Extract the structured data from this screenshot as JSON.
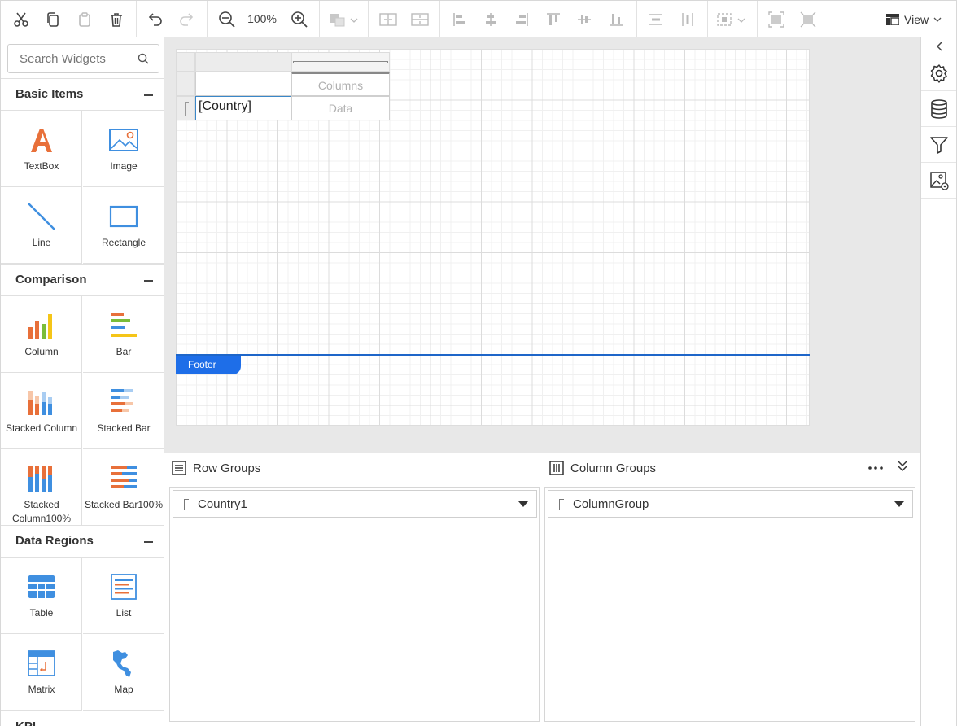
{
  "toolbar": {
    "zoom": "100%",
    "view_label": "View"
  },
  "search": {
    "placeholder": "Search Widgets"
  },
  "categories": {
    "basic": "Basic Items",
    "comparison": "Comparison",
    "data_regions": "Data Regions",
    "kpi": "KPI"
  },
  "widgets": {
    "textbox": "TextBox",
    "image": "Image",
    "line": "Line",
    "rectangle": "Rectangle",
    "column": "Column",
    "bar": "Bar",
    "stacked_column": "Stacked Column",
    "stacked_bar": "Stacked Bar",
    "stacked_column100": "Stacked Column100%",
    "stacked_bar100": "Stacked Bar100%",
    "table": "Table",
    "list": "List",
    "matrix": "Matrix",
    "map": "Map"
  },
  "design": {
    "row_cell": "[Country]",
    "columns_placeholder": "Columns",
    "data_placeholder": "Data",
    "footer_label": "Footer"
  },
  "grouping": {
    "row_groups_title": "Row Groups",
    "column_groups_title": "Column Groups",
    "row_group_field": "Country1",
    "column_group_field": "ColumnGroup"
  },
  "colors": {
    "accent_blue": "#1e6ee8",
    "orange": "#e8703a",
    "icon_blue": "#3f8fe0"
  }
}
